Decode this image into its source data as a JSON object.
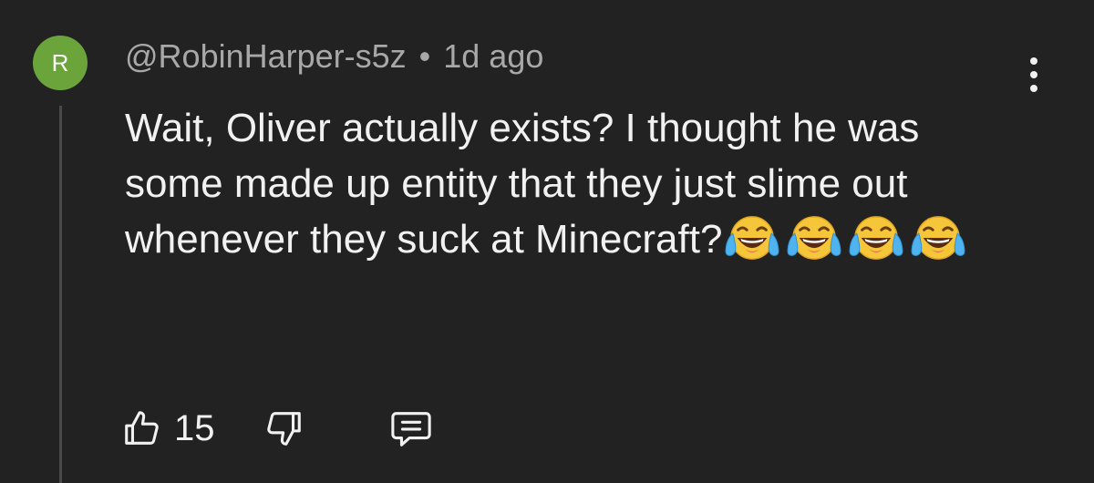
{
  "comment": {
    "avatar_letter": "R",
    "avatar_color": "#6aa43a",
    "author": "@RobinHarper-s5z",
    "separator": "•",
    "timestamp": "1d ago",
    "text": "Wait, Oliver actually exists? I thought he was some made up entity that they just slime out whenever they suck at Minecraft?",
    "emojis": [
      "face-with-tears-of-joy",
      "face-with-tears-of-joy",
      "face-with-tears-of-joy",
      "face-with-tears-of-joy"
    ],
    "more_icon": "more-vertical-icon"
  },
  "actions": {
    "like_icon": "thumbs-up-icon",
    "like_count": "15",
    "dislike_icon": "thumbs-down-icon",
    "reply_icon": "comment-icon"
  },
  "theme": {
    "background": "#222222",
    "text": "#f1f1f1",
    "meta_text": "#a8a8a8",
    "thread_line": "#4a4a4a"
  }
}
